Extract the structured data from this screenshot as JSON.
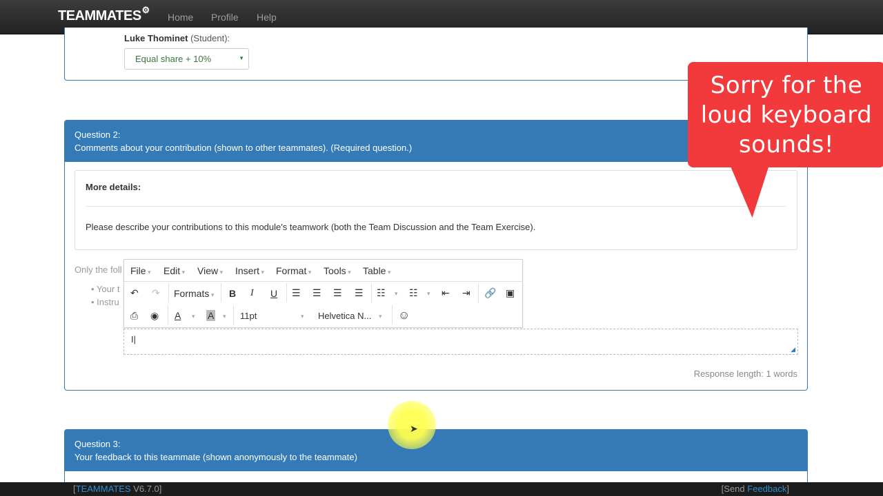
{
  "navbar": {
    "brand": "TEAMMATES",
    "links": [
      "Home",
      "Profile",
      "Help"
    ]
  },
  "q1": {
    "student_name": "Luke Thominet",
    "student_role": "(Student):",
    "selected_option": "Equal share + 10%"
  },
  "q2": {
    "title": "Question 2:",
    "subtitle": "Comments about your contribution (shown to other teammates). (Required question.)",
    "details_title": "More details:",
    "details_text": "Please describe your contributions to this module's teamwork (both the Team Discussion and the Team Exercise).",
    "instructions": "Only the foll",
    "bullets": [
      "Your t",
      "Instru"
    ],
    "editor": {
      "menus": [
        "File",
        "Edit",
        "View",
        "Insert",
        "Format",
        "Tools",
        "Table"
      ],
      "formats_label": "Formats",
      "font_size": "11pt",
      "font_family": "Helvetica N...",
      "content": "I"
    },
    "response_length": "Response length: 1 words"
  },
  "q3": {
    "title": "Question 3:",
    "subtitle": "Your feedback to this teammate (shown anonymously to the teammate)"
  },
  "bubble": {
    "line1": "Sorry for the",
    "line2": "loud keyboard",
    "line3": "sounds!"
  },
  "footer": {
    "version_link": "TEAMMATES",
    "version": "V6.7.0",
    "feedback_prefix": "Send",
    "feedback_link": "Feedback"
  },
  "colors": {
    "primary": "#337ab7",
    "bubble": "#f2393c",
    "success_text": "#3c763d"
  }
}
